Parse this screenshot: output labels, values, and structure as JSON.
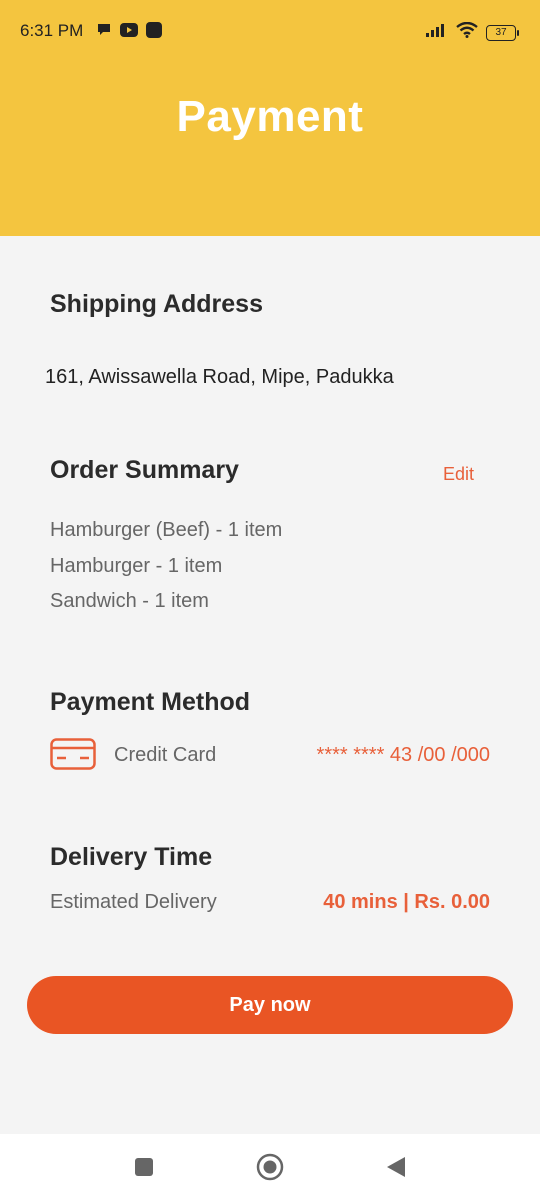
{
  "status_bar": {
    "time": "6:31 PM",
    "battery": "37",
    "icons_left": [
      "chat-icon",
      "youtube-icon",
      "app-icon"
    ],
    "icons_right": [
      "signal-icon",
      "wifi-icon",
      "battery-icon"
    ]
  },
  "header": {
    "title": "Payment",
    "background_color": "#f4c53f"
  },
  "shipping": {
    "title": "Shipping Address",
    "address": "161, Awissawella Road, Mipe, Padukka"
  },
  "order_summary": {
    "title": "Order Summary",
    "edit_label": "Edit",
    "items": [
      "Hamburger (Beef) - 1 item",
      "Hamburger - 1 item",
      "Sandwich - 1 item"
    ]
  },
  "payment_method": {
    "title": "Payment Method",
    "method_label": "Credit Card",
    "card_number": "**** **** 43 /00 /000",
    "icon": "credit-card-icon"
  },
  "delivery": {
    "title": "Delivery Time",
    "label": "Estimated Delivery",
    "value": "40 mins | Rs. 0.00"
  },
  "actions": {
    "pay_label": "Pay now",
    "accent_color": "#e95524"
  },
  "nav": {
    "items": [
      "recents-icon",
      "home-icon",
      "back-icon"
    ]
  }
}
